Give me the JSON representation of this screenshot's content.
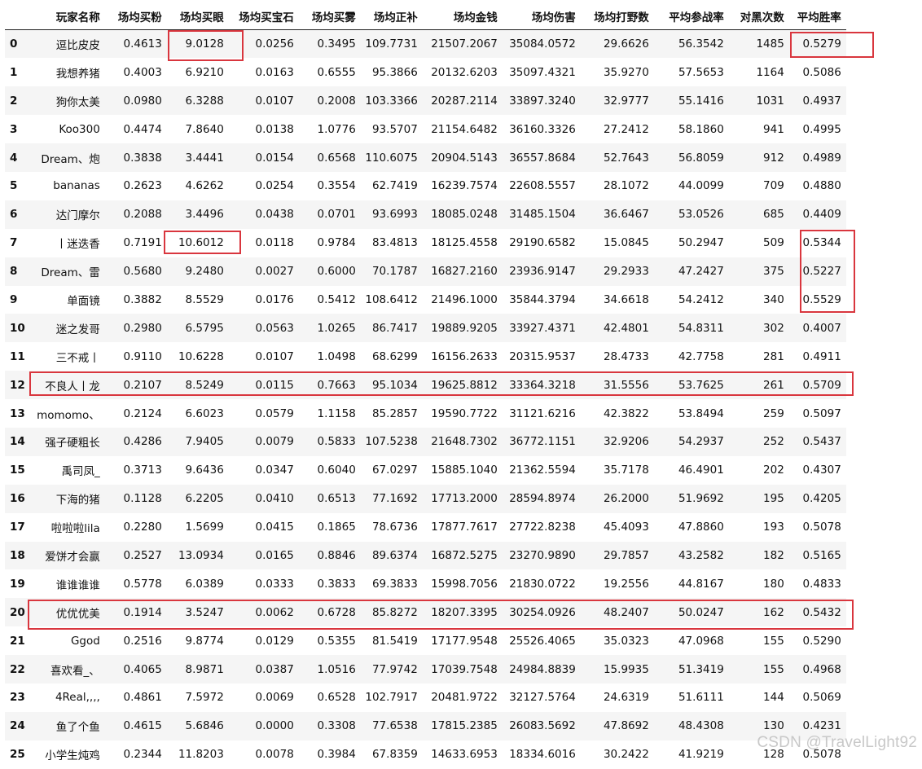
{
  "table": {
    "columns": [
      "玩家名称",
      "场均买粉",
      "场均买眼",
      "场均买宝石",
      "场均买雾",
      "场均正补",
      "场均金钱",
      "场均伤害",
      "场均打野数",
      "平均参战率",
      "对黑次数",
      "平均胜率"
    ],
    "rows": [
      {
        "index": "0",
        "cells": [
          "逗比皮皮",
          "0.4613",
          "9.0128",
          "0.0256",
          "0.3495",
          "109.7731",
          "21507.2067",
          "35084.0572",
          "29.6626",
          "56.3542",
          "1485",
          "0.5279"
        ]
      },
      {
        "index": "1",
        "cells": [
          "我想养猪",
          "0.4003",
          "6.9210",
          "0.0163",
          "0.6555",
          "95.3866",
          "20132.6203",
          "35097.4321",
          "35.9270",
          "57.5653",
          "1164",
          "0.5086"
        ]
      },
      {
        "index": "2",
        "cells": [
          "狗你太美",
          "0.0980",
          "6.3288",
          "0.0107",
          "0.2008",
          "103.3366",
          "20287.2114",
          "33897.3240",
          "32.9777",
          "55.1416",
          "1031",
          "0.4937"
        ]
      },
      {
        "index": "3",
        "cells": [
          "Koo300",
          "0.4474",
          "7.8640",
          "0.0138",
          "1.0776",
          "93.5707",
          "21154.6482",
          "36160.3326",
          "27.2412",
          "58.1860",
          "941",
          "0.4995"
        ]
      },
      {
        "index": "4",
        "cells": [
          "Dream、炮",
          "0.3838",
          "3.4441",
          "0.0154",
          "0.6568",
          "110.6075",
          "20904.5143",
          "36557.8684",
          "52.7643",
          "56.8059",
          "912",
          "0.4989"
        ]
      },
      {
        "index": "5",
        "cells": [
          "bananas",
          "0.2623",
          "4.6262",
          "0.0254",
          "0.3554",
          "62.7419",
          "16239.7574",
          "22608.5557",
          "28.1072",
          "44.0099",
          "709",
          "0.4880"
        ]
      },
      {
        "index": "6",
        "cells": [
          "达门摩尔",
          "0.2088",
          "3.4496",
          "0.0438",
          "0.0701",
          "93.6993",
          "18085.0248",
          "31485.1504",
          "36.6467",
          "53.0526",
          "685",
          "0.4409"
        ]
      },
      {
        "index": "7",
        "cells": [
          "丨迷迭香",
          "0.7191",
          "10.6012",
          "0.0118",
          "0.9784",
          "83.4813",
          "18125.4558",
          "29190.6582",
          "15.0845",
          "50.2947",
          "509",
          "0.5344"
        ]
      },
      {
        "index": "8",
        "cells": [
          "Dream、雷",
          "0.5680",
          "9.2480",
          "0.0027",
          "0.6000",
          "70.1787",
          "16827.2160",
          "23936.9147",
          "29.2933",
          "47.2427",
          "375",
          "0.5227"
        ]
      },
      {
        "index": "9",
        "cells": [
          "单面镜",
          "0.3882",
          "8.5529",
          "0.0176",
          "0.5412",
          "108.6412",
          "21496.1000",
          "35844.3794",
          "34.6618",
          "54.2412",
          "340",
          "0.5529"
        ]
      },
      {
        "index": "10",
        "cells": [
          "迷之发哥",
          "0.2980",
          "6.5795",
          "0.0563",
          "1.0265",
          "86.7417",
          "19889.9205",
          "33927.4371",
          "42.4801",
          "54.8311",
          "302",
          "0.4007"
        ]
      },
      {
        "index": "11",
        "cells": [
          "三不戒丨",
          "0.9110",
          "10.6228",
          "0.0107",
          "1.0498",
          "68.6299",
          "16156.2633",
          "20315.9537",
          "28.4733",
          "42.7758",
          "281",
          "0.4911"
        ]
      },
      {
        "index": "12",
        "cells": [
          "不良人丨龙",
          "0.2107",
          "8.5249",
          "0.0115",
          "0.7663",
          "95.1034",
          "19625.8812",
          "33364.3218",
          "31.5556",
          "53.7625",
          "261",
          "0.5709"
        ]
      },
      {
        "index": "13",
        "cells": [
          "momomo、",
          "0.2124",
          "6.6023",
          "0.0579",
          "1.1158",
          "85.2857",
          "19590.7722",
          "31121.6216",
          "42.3822",
          "53.8494",
          "259",
          "0.5097"
        ]
      },
      {
        "index": "14",
        "cells": [
          "强子硬粗长",
          "0.4286",
          "7.9405",
          "0.0079",
          "0.5833",
          "107.5238",
          "21648.7302",
          "36772.1151",
          "32.9206",
          "54.2937",
          "252",
          "0.5437"
        ]
      },
      {
        "index": "15",
        "cells": [
          "禹司凤_",
          "0.3713",
          "9.6436",
          "0.0347",
          "0.6040",
          "67.0297",
          "15885.1040",
          "21362.5594",
          "35.7178",
          "46.4901",
          "202",
          "0.4307"
        ]
      },
      {
        "index": "16",
        "cells": [
          "下海的猪",
          "0.1128",
          "6.2205",
          "0.0410",
          "0.6513",
          "77.1692",
          "17713.2000",
          "28594.8974",
          "26.2000",
          "51.9692",
          "195",
          "0.4205"
        ]
      },
      {
        "index": "17",
        "cells": [
          "啦啦啦lila",
          "0.2280",
          "1.5699",
          "0.0415",
          "0.1865",
          "78.6736",
          "17877.7617",
          "27722.8238",
          "45.4093",
          "47.8860",
          "193",
          "0.5078"
        ]
      },
      {
        "index": "18",
        "cells": [
          "爱饼才会赢",
          "0.2527",
          "13.0934",
          "0.0165",
          "0.8846",
          "89.6374",
          "16872.5275",
          "23270.9890",
          "29.7857",
          "43.2582",
          "182",
          "0.5165"
        ]
      },
      {
        "index": "19",
        "cells": [
          "谁谁谁谁",
          "0.5778",
          "6.0389",
          "0.0333",
          "0.3833",
          "69.3833",
          "15998.7056",
          "21830.0722",
          "19.2556",
          "44.8167",
          "180",
          "0.4833"
        ]
      },
      {
        "index": "20",
        "cells": [
          "优优优美",
          "0.1914",
          "3.5247",
          "0.0062",
          "0.6728",
          "85.8272",
          "18207.3395",
          "30254.0926",
          "48.2407",
          "50.0247",
          "162",
          "0.5432"
        ]
      },
      {
        "index": "21",
        "cells": [
          "Ggod",
          "0.2516",
          "9.8774",
          "0.0129",
          "0.5355",
          "81.5419",
          "17177.9548",
          "25526.4065",
          "35.0323",
          "47.0968",
          "155",
          "0.5290"
        ]
      },
      {
        "index": "22",
        "cells": [
          "喜欢看_、",
          "0.4065",
          "8.9871",
          "0.0387",
          "1.0516",
          "77.9742",
          "17039.7548",
          "24984.8839",
          "15.9935",
          "51.3419",
          "155",
          "0.4968"
        ]
      },
      {
        "index": "23",
        "cells": [
          "4Real,,,,",
          "0.4861",
          "7.5972",
          "0.0069",
          "0.6528",
          "102.7917",
          "20481.9722",
          "32127.5764",
          "24.6319",
          "51.6111",
          "144",
          "0.5069"
        ]
      },
      {
        "index": "24",
        "cells": [
          "鱼了个鱼",
          "0.4615",
          "5.6846",
          "0.0000",
          "0.3308",
          "77.6538",
          "17815.2385",
          "26083.5692",
          "47.8692",
          "48.4308",
          "130",
          "0.4231"
        ]
      },
      {
        "index": "25",
        "cells": [
          "小学生炖鸡",
          "0.2344",
          "11.8203",
          "0.0078",
          "0.3984",
          "67.8359",
          "14633.6953",
          "18334.6016",
          "30.2422",
          "41.9219",
          "128",
          "0.5078"
        ]
      }
    ]
  },
  "watermark": "CSDN @TravelLight92",
  "colors": {
    "highlight": "#d9363e",
    "stripe": "#f5f5f5"
  }
}
